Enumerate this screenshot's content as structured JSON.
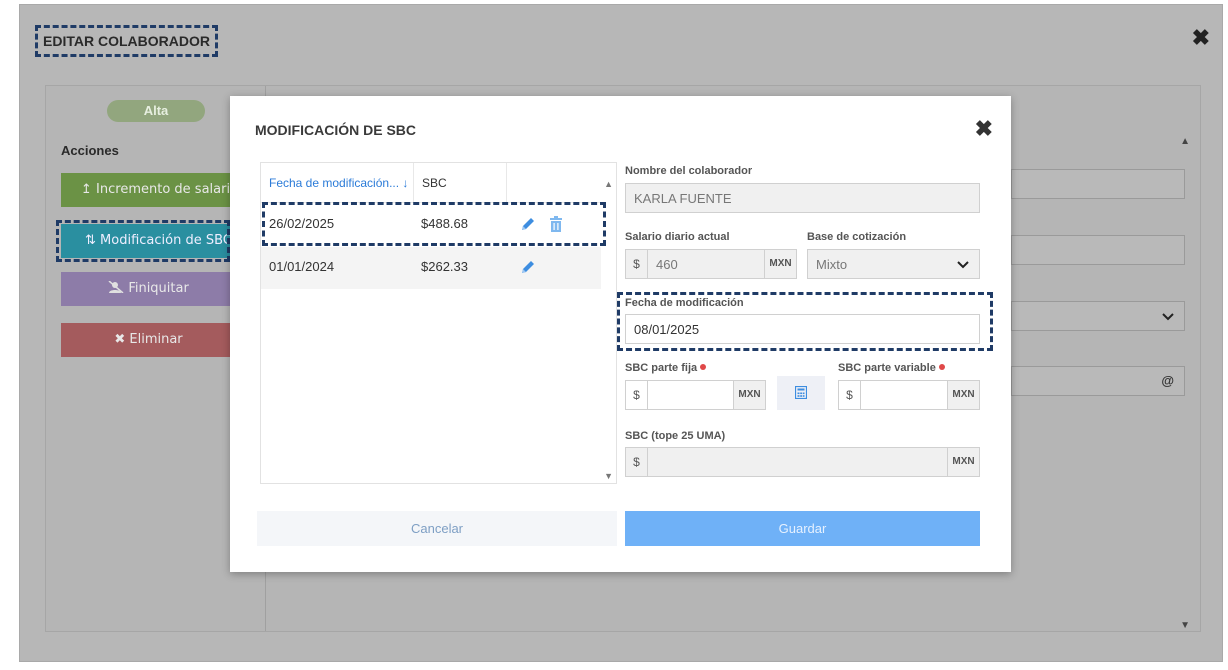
{
  "outer": {
    "title": "EDITAR COLABORADOR",
    "close": "✖",
    "status_badge": "Alta",
    "actions_label": "Acciones",
    "actions": {
      "increment": "Incremento de salario",
      "modify_sbc": "Modificación de SBC",
      "finiquitar": "Finiquitar",
      "delete": "Eliminar"
    },
    "icons": {
      "increment": "↥",
      "modify_sbc": "⇅",
      "finiquitar": "user-slash-icon",
      "delete": "✖"
    }
  },
  "modal": {
    "title": "MODIFICACIÓN DE SBC",
    "close": "✖",
    "grid": {
      "columns": [
        "Fecha de modificación...",
        "SBC"
      ],
      "sort_indicator": "↓",
      "rows": [
        {
          "date": "26/02/2025",
          "sbc": "$488.68",
          "actions": [
            "edit",
            "delete"
          ]
        },
        {
          "date": "01/01/2024",
          "sbc": "$262.33",
          "actions": [
            "edit"
          ]
        }
      ]
    },
    "form": {
      "name_label": "Nombre del colaborador",
      "name_value": "KARLA FUENTE",
      "salary_label": "Salario diario actual",
      "salary_prefix": "$",
      "salary_value": "460",
      "salary_suffix": "MXN",
      "base_label": "Base de cotización",
      "base_value": "Mixto",
      "date_label": "Fecha de modificación",
      "date_value": "08/01/2025",
      "sbc_fixed_label": "SBC parte fija",
      "sbc_fixed_prefix": "$",
      "sbc_fixed_suffix": "MXN",
      "sbc_variable_label": "SBC parte variable",
      "sbc_variable_prefix": "$",
      "sbc_variable_suffix": "MXN",
      "sbc_cap_label": "SBC (tope 25 UMA)",
      "sbc_cap_prefix": "$",
      "sbc_cap_suffix": "MXN"
    },
    "buttons": {
      "cancel": "Cancelar",
      "save": "Guardar"
    }
  },
  "colors": {
    "primary": "#6fb1f7",
    "link": "#2b7bd8",
    "required": "#e04848",
    "highlight_outline": "#1f3b66"
  }
}
